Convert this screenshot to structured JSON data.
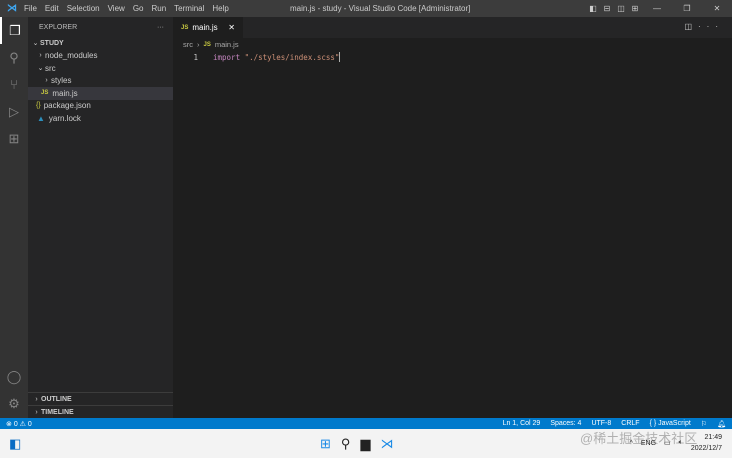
{
  "window": {
    "title": "main.js - study - Visual Studio Code [Administrator]"
  },
  "menu": [
    "File",
    "Edit",
    "Selection",
    "View",
    "Go",
    "Run",
    "Terminal",
    "Help"
  ],
  "sidebar": {
    "title": "EXPLORER",
    "more": "···",
    "root": "STUDY",
    "items": [
      {
        "label": "node_modules"
      },
      {
        "label": "src"
      },
      {
        "label": "styles"
      },
      {
        "label": "main.js"
      },
      {
        "label": "package.json"
      },
      {
        "label": "yarn.lock"
      }
    ],
    "outline": "OUTLINE",
    "timeline": "TIMELINE"
  },
  "editor": {
    "tab": "main.js",
    "breadcrumb": [
      "src",
      "main.js"
    ],
    "lines": [
      {
        "num": "1",
        "keyword": "import",
        "string": "\"./styles/index.scss\""
      }
    ]
  },
  "status": {
    "errors": "0",
    "warnings": "0",
    "position": "Ln 1, Col 29",
    "spaces": "Spaces: 4",
    "encoding": "UTF-8",
    "eol": "CRLF",
    "language": "{ } JavaScript"
  },
  "taskbar": {
    "lang": "ENG",
    "time": "21:49",
    "date": "2022/12/7"
  },
  "watermark": "@稀土掘金技术社区"
}
